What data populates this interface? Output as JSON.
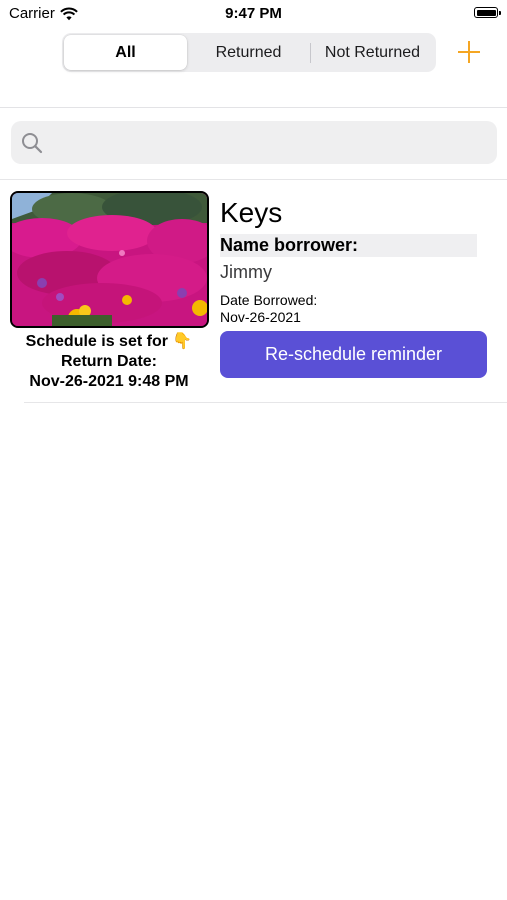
{
  "status_bar": {
    "carrier": "Carrier",
    "time": "9:47 PM"
  },
  "filter": {
    "segments": [
      "All",
      "Returned",
      "Not Returned"
    ],
    "selected": "All"
  },
  "search": {
    "placeholder": "",
    "value": ""
  },
  "items": [
    {
      "title": "Keys",
      "borrower_label": "Name borrower:",
      "borrower_name": "Jimmy",
      "date_label": "Date Borrowed:",
      "date_value": "Nov-26-2021",
      "schedule_line1": "Schedule is set for 👇",
      "schedule_line2": "Return Date:",
      "schedule_line3": "Nov-26-2021 9:48 PM",
      "button_label": "Re-schedule reminder"
    }
  ],
  "colors": {
    "accent": "#f5a623",
    "button": "#5a50d6",
    "segment_bg": "#ededef",
    "search_bg": "#efeff0"
  },
  "icons": {
    "add": "plus-icon",
    "search": "search-icon",
    "wifi": "wifi-icon",
    "battery": "battery-icon"
  }
}
